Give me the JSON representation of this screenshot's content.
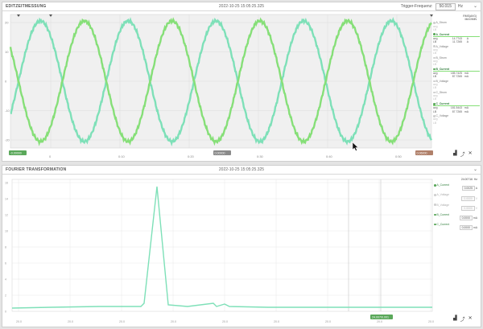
{
  "colors": {
    "accent_a": "#7ee0b8",
    "accent_b": "#86df78",
    "green_tag": "#5aa85a",
    "gray_tag": "#8a8a8a",
    "brown_tag": "#b0806a"
  },
  "panel1": {
    "title": "EDITZEITMESSUNG",
    "timestamp": "2022-10-25 15:05:25.325",
    "trigger_label": "Trigger-Frequenz:",
    "trigger_value": "50.015",
    "trigger_unit": "Hz",
    "chevron": "⌄",
    "y_ticks": [
      "20",
      "10",
      "0",
      "-10",
      "-20"
    ],
    "x_ticks": [
      "0",
      "0:10",
      "0:20",
      "0:30",
      "0:40",
      "0:50"
    ],
    "tag_left": "-0.00000",
    "tag_mid": "0.00000",
    "tag_right": "0.06000",
    "side_header": [
      "RMS(AVG)",
      "MAX/MIN"
    ],
    "channels": [
      {
        "name": "A_Strom",
        "active": false,
        "rows": [
          [
            "avg",
            "",
            ""
          ],
          [
            "LB",
            "",
            ""
          ]
        ]
      },
      {
        "name": "A_Current",
        "active": true,
        "rows": [
          [
            "avg",
            "14.7743",
            "A"
          ],
          [
            "LB",
            "11.7265",
            "A"
          ]
        ]
      },
      {
        "name": "A_Voltage",
        "active": false,
        "rows": [
          [
            "avg",
            "",
            ""
          ],
          [
            "LB",
            "",
            ""
          ]
        ]
      },
      {
        "name": "B_Strom",
        "active": false,
        "rows": [
          [
            "avg",
            "",
            ""
          ],
          [
            "LB",
            "",
            ""
          ]
        ]
      },
      {
        "name": "B_Current",
        "active": true,
        "rows": [
          [
            "avg",
            "185.7425",
            "mA"
          ],
          [
            "LB",
            "87.7265",
            "mA"
          ]
        ]
      },
      {
        "name": "B_Voltage",
        "active": false,
        "rows": [
          [
            "avg",
            "",
            ""
          ],
          [
            "LB",
            "",
            ""
          ]
        ]
      },
      {
        "name": "C_Strom",
        "active": false,
        "rows": [
          [
            "avg",
            "",
            ""
          ],
          [
            "LB",
            "",
            ""
          ]
        ]
      },
      {
        "name": "C_Current",
        "active": true,
        "rows": [
          [
            "avg",
            "181.5443",
            "mA"
          ],
          [
            "LB",
            "87.7265",
            "mA"
          ]
        ]
      },
      {
        "name": "C_Voltage",
        "active": false,
        "rows": [
          [
            "avg",
            "",
            ""
          ],
          [
            "LB",
            "",
            ""
          ]
        ]
      }
    ]
  },
  "panel2": {
    "title": "FOURIER TRANSFORMATION",
    "timestamp": "2022-10-25 15:05:25.325",
    "chevron": "⌄",
    "y_ticks": [
      "16",
      "14",
      "12",
      "10",
      "8",
      "6",
      "4",
      "2",
      "0"
    ],
    "x_ticks": [
      "20.0",
      "20.0",
      "20.0",
      "20.0",
      "20.0",
      "20.0",
      "20.0",
      "20.0",
      "20.0"
    ],
    "marker_tag": "24.007/0.001",
    "side_header_value": "24.00716",
    "side_header_unit": "Hz",
    "channels": [
      {
        "name": "A_Current",
        "value": "0.0025",
        "unit": "A",
        "active": true
      },
      {
        "name": "A_Voltage",
        "value": "0.0000",
        "unit": "V",
        "active": false
      },
      {
        "name": "B_Voltage",
        "value": "0.0000",
        "unit": "V",
        "active": false
      },
      {
        "name": "B_Current",
        "value": "0.0000",
        "unit": "mA",
        "active": true
      },
      {
        "name": "C_Current",
        "value": "0.0000",
        "unit": "mA",
        "active": true
      }
    ]
  },
  "icons": [
    "chart-icon",
    "trend-icon",
    "close-icon"
  ]
}
